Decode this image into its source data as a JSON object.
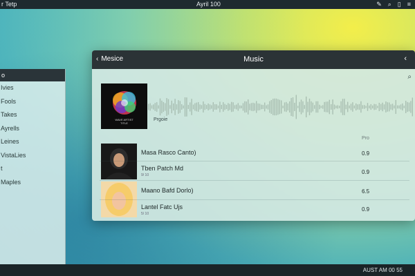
{
  "topbar": {
    "app_label": "r Tetp",
    "title": "Ayril 100",
    "icons": [
      "edit-icon",
      "search-icon",
      "document-icon",
      "menu-icon"
    ]
  },
  "left_panel": {
    "header": "o",
    "items": [
      "Ivies",
      "Fools",
      "Takes",
      "Ayrells",
      "Leines",
      "VistaLies",
      "t",
      "Maples"
    ]
  },
  "window": {
    "back_label": "Mesice",
    "title": "Music"
  },
  "album": {
    "caption": "WAVE ARTIST\nTITLE",
    "label": "Prgoie"
  },
  "column_header": "Pro",
  "tracks": [
    {
      "title": "Masa Rasco Canto)",
      "sub": "",
      "value": "0.9"
    },
    {
      "title": "Tben Patch Md",
      "sub": "9/ 10",
      "value": "0.9"
    },
    {
      "title": "Maano Bafd Dorlo)",
      "sub": "",
      "value": "6.5"
    },
    {
      "title": "Lantel Fatc Ujs",
      "sub": "5/ 10",
      "value": "0.9"
    }
  ],
  "bottombar": {
    "status": "AUST AM 00 55"
  },
  "colors": {
    "accent": "#2b3336",
    "bg_top": "#f3ee4a",
    "bg_bottom": "#2f8ea8"
  }
}
